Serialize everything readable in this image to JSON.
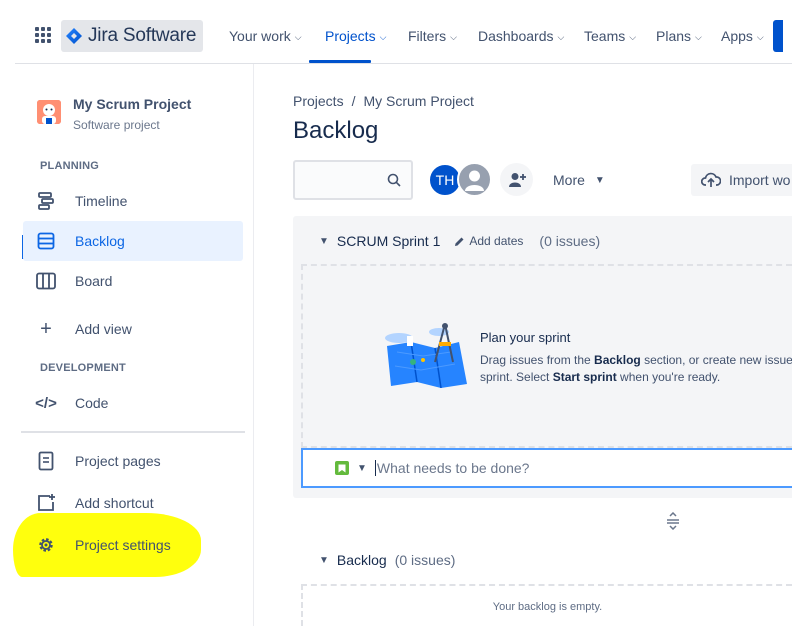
{
  "app": {
    "logo_text": "Jira Software"
  },
  "nav": {
    "items": [
      {
        "label": "Your work"
      },
      {
        "label": "Projects"
      },
      {
        "label": "Filters"
      },
      {
        "label": "Dashboards"
      },
      {
        "label": "Teams"
      },
      {
        "label": "Plans"
      },
      {
        "label": "Apps"
      }
    ],
    "active": "Projects"
  },
  "sidebar": {
    "project_name": "My Scrum Project",
    "project_type": "Software project",
    "planning_heading": "PLANNING",
    "planning_items": [
      {
        "label": "Timeline",
        "icon": "timeline-icon"
      },
      {
        "label": "Backlog",
        "icon": "backlog-icon",
        "selected": true
      },
      {
        "label": "Board",
        "icon": "board-icon"
      }
    ],
    "add_view": "Add view",
    "development_heading": "DEVELOPMENT",
    "code": "Code",
    "project_pages": "Project pages",
    "add_shortcut": "Add shortcut",
    "project_settings": "Project settings",
    "highlight_color": "#ffff00"
  },
  "main": {
    "breadcrumb": {
      "projects": "Projects",
      "separator": "/",
      "project": "My Scrum Project"
    },
    "title": "Backlog",
    "search": {
      "placeholder": "",
      "value": ""
    },
    "avatar_initials": "TH",
    "more_label": "More",
    "import_label": "Import wo",
    "sprint": {
      "name": "SCRUM Sprint 1",
      "add_dates": "Add dates",
      "issue_count": "(0 issues)",
      "empty_title": "Plan your sprint",
      "empty_text_1": "Drag issues from the ",
      "empty_bold_1": "Backlog",
      "empty_text_2": " section, or create new issue",
      "empty_text_3": "sprint. Select ",
      "empty_bold_2": "Start sprint",
      "empty_text_4": " when you're ready."
    },
    "create_placeholder": "What needs to be done?",
    "backlog": {
      "name": "Backlog",
      "issue_count": "(0 issues)",
      "empty": "Your backlog is empty."
    }
  },
  "colors": {
    "brand_blue": "#0052cc",
    "selected_bg": "#e9f2ff",
    "story_green": "#63ba3c"
  }
}
